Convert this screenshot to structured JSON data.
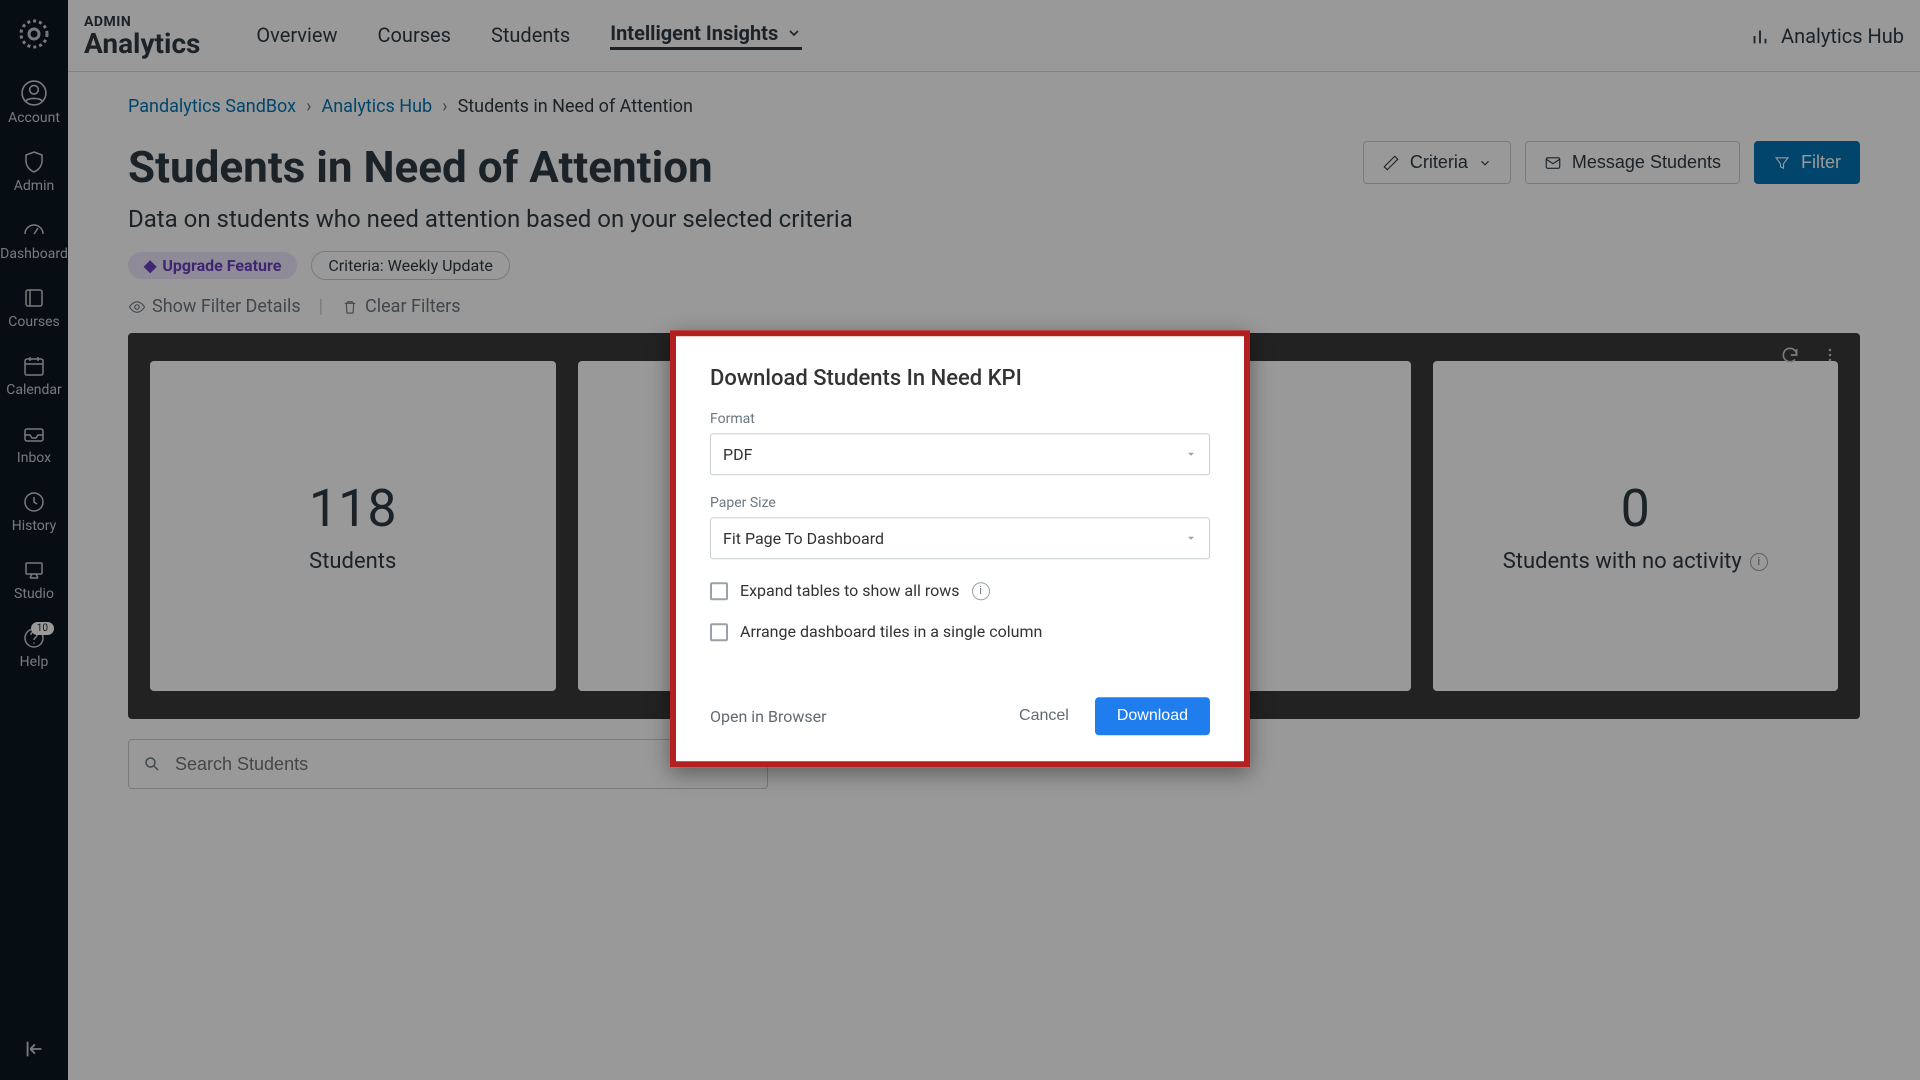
{
  "sidebar": {
    "items": [
      {
        "label": "Account"
      },
      {
        "label": "Admin"
      },
      {
        "label": "Dashboard"
      },
      {
        "label": "Courses"
      },
      {
        "label": "Calendar"
      },
      {
        "label": "Inbox"
      },
      {
        "label": "History"
      },
      {
        "label": "Studio"
      },
      {
        "label": "Help",
        "badge": "10"
      }
    ]
  },
  "header": {
    "admin": "ADMIN",
    "title": "Analytics",
    "tabs": [
      "Overview",
      "Courses",
      "Students",
      "Intelligent Insights"
    ],
    "active_tab": "Intelligent Insights",
    "hub_label": "Analytics Hub"
  },
  "breadcrumb": {
    "items": [
      {
        "label": "Pandalytics SandBox",
        "link": true
      },
      {
        "label": "Analytics Hub",
        "link": true
      },
      {
        "label": "Students in Need of Attention",
        "link": false
      }
    ]
  },
  "page": {
    "title": "Students in Need of Attention",
    "subtitle": "Data on students who need attention based on your selected criteria",
    "actions": {
      "criteria": "Criteria",
      "message": "Message Students",
      "filter": "Filter"
    },
    "chips": {
      "upgrade": "Upgrade Feature",
      "criteria": "Criteria: Weekly Update"
    },
    "filter_links": {
      "show": "Show Filter Details",
      "clear": "Clear Filters"
    }
  },
  "kpis": [
    {
      "value": "118",
      "label": "Students"
    },
    {
      "value": "",
      "label": ""
    },
    {
      "value": "",
      "label": ""
    },
    {
      "value": "0",
      "label": "Students with no activity"
    }
  ],
  "search": {
    "placeholder": "Search Students"
  },
  "modal": {
    "title": "Download Students In Need KPI",
    "format_label": "Format",
    "format_value": "PDF",
    "paper_label": "Paper Size",
    "paper_value": "Fit Page To Dashboard",
    "cb_expand": "Expand tables to show all rows",
    "cb_arrange": "Arrange dashboard tiles in a single column",
    "open": "Open in Browser",
    "cancel": "Cancel",
    "download": "Download"
  }
}
